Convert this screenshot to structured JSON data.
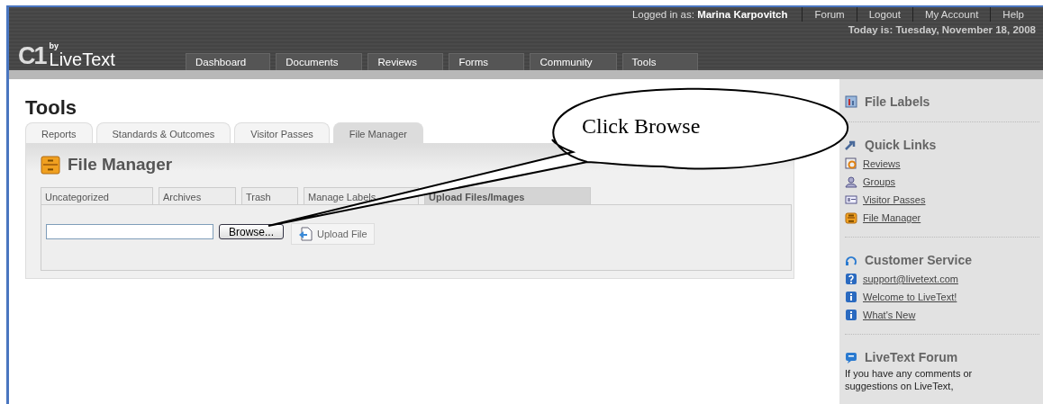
{
  "header": {
    "logo": {
      "mark": "C1",
      "by": "by",
      "name": "LiveText"
    },
    "login": "Logged in as: **Marina Karpovitch**",
    "links": [
      "Forum",
      "Logout",
      "My Account",
      "Help"
    ],
    "date": "Today is: Tuesday, November 18, 2008",
    "nav": [
      "Dashboard",
      "Documents",
      "Reviews",
      "Forms",
      "Community",
      "Tools"
    ]
  },
  "main": {
    "title": "Tools",
    "tabs": [
      {
        "label": "Reports",
        "selected": false
      },
      {
        "label": "Standards & Outcomes",
        "selected": false
      },
      {
        "label": "Visitor Passes",
        "selected": false
      },
      {
        "label": "File Manager",
        "selected": true
      }
    ],
    "panel_title": "File Manager",
    "subtabs": [
      {
        "label": "Uncategorized",
        "selected": false
      },
      {
        "label": "Archives",
        "selected": false
      },
      {
        "label": "Trash",
        "selected": false
      },
      {
        "label": "Manage Labels",
        "selected": false
      },
      {
        "label": "Upload Files/Images",
        "selected": true
      }
    ],
    "browse_button": "Browse...",
    "upload_button": "Upload File"
  },
  "sidebar": [
    {
      "title": "File Labels"
    },
    {
      "title": "Quick Links",
      "links": [
        "Reviews",
        "Groups",
        "Visitor Passes",
        "File Manager"
      ]
    },
    {
      "title": "Customer Service",
      "links": [
        "support@livetext.com",
        "Welcome to LiveText!",
        "What's New"
      ]
    },
    {
      "title": "LiveText Forum",
      "text": "If you have any comments or suggestions on LiveText,"
    }
  ],
  "callout": {
    "text": "Click Browse"
  }
}
